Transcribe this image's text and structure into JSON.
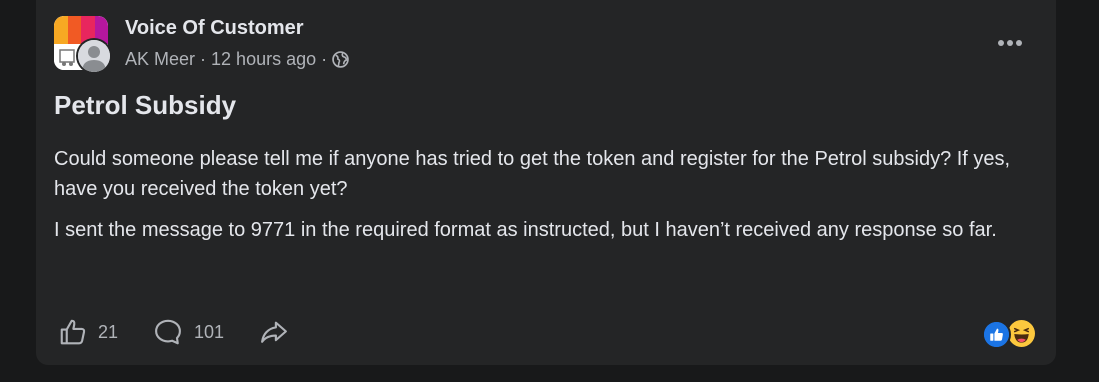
{
  "post": {
    "group_name": "Voice Of Customer",
    "author": "AK Meer",
    "time": "12 hours ago",
    "separator": "·",
    "privacy_icon": "globe-icon",
    "title": "Petrol Subsidy",
    "paragraphs": [
      "Could someone please tell me if anyone has tried to get the token and register for the Petrol subsidy? If yes, have you received the token yet?",
      "I sent the message to 9771 in the required format as instructed, but I haven’t received any response so far."
    ]
  },
  "actions": {
    "like_count": "21",
    "comment_count": "101"
  },
  "reactions": [
    "like-reaction-icon",
    "haha-reaction-icon"
  ],
  "colors": {
    "page_bg": "#18191a",
    "card_bg": "#242526",
    "primary_text": "#e4e6eb",
    "secondary_text": "#b0b3b8",
    "like_blue": "#1b74e4"
  }
}
